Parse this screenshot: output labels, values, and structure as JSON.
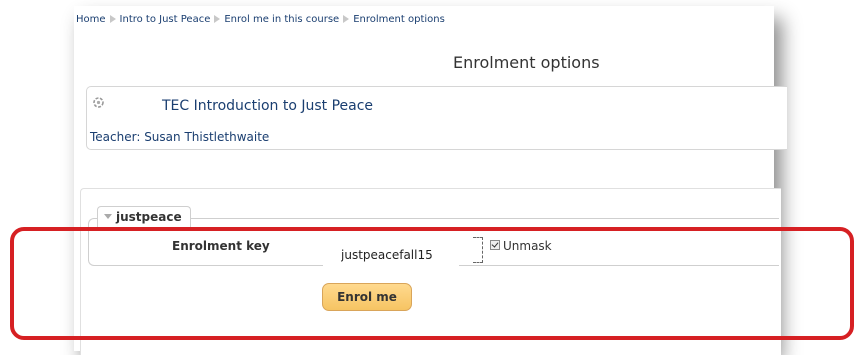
{
  "breadcrumb": {
    "items": [
      "Home",
      "Intro to Just Peace",
      "Enrol me in this course",
      "Enrolment options"
    ]
  },
  "page": {
    "title": "Enrolment options"
  },
  "course": {
    "name": "TEC Introduction to Just Peace",
    "teacher": "Teacher: Susan Thistlethwaite",
    "icon": "course-icon"
  },
  "form": {
    "legend": "justpeace",
    "key_label": "Enrolment key",
    "key_value": "justpeacefall15",
    "unmask_label": "Unmask",
    "unmask_checked": true,
    "submit_label": "Enrol me"
  },
  "colors": {
    "link": "#1a3e70",
    "button": "#f6c463",
    "highlight": "#d62023"
  }
}
